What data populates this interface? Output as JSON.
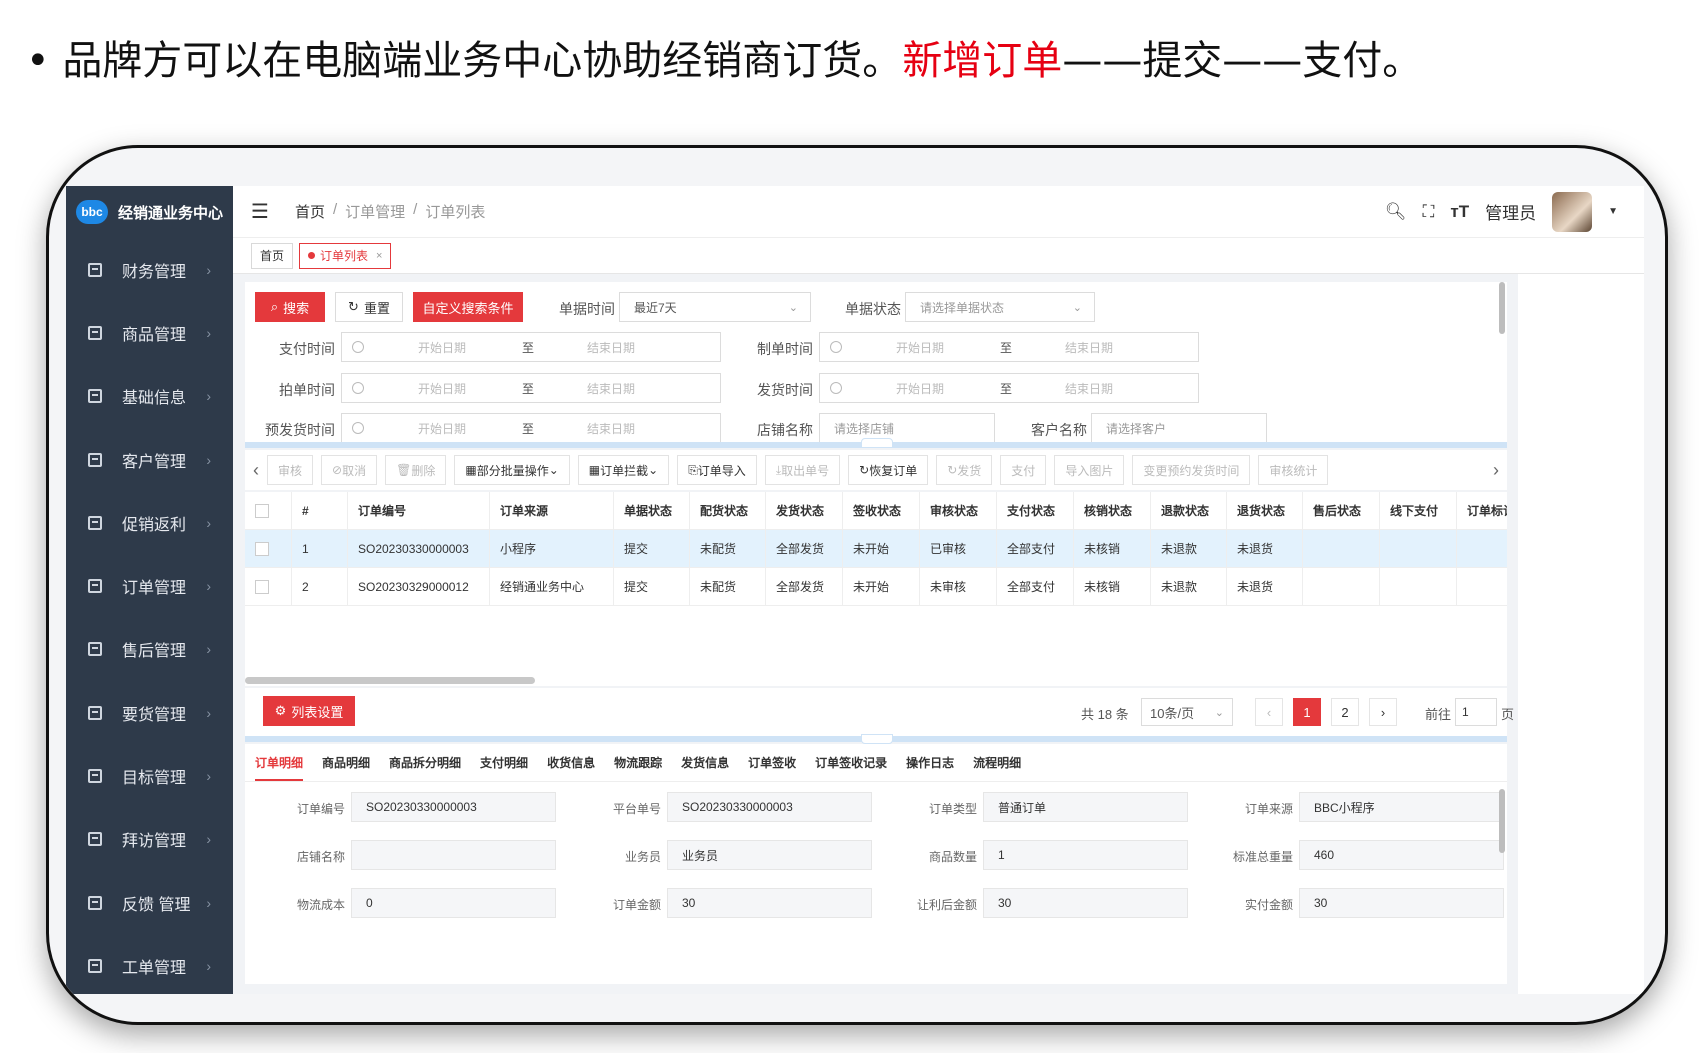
{
  "caption": {
    "text": "品牌方可以在电脑端业务中心协助经销商订货。",
    "highlight": "新增订单",
    "rest": "——提交——支付。"
  },
  "app": {
    "logo_text": "bbc",
    "title": "经销通业务中心"
  },
  "sidebar": {
    "items": [
      {
        "label": "财务管理"
      },
      {
        "label": "商品管理"
      },
      {
        "label": "基础信息"
      },
      {
        "label": "客户管理"
      },
      {
        "label": "促销返利"
      },
      {
        "label": "订单管理"
      },
      {
        "label": "售后管理"
      },
      {
        "label": "要货管理"
      },
      {
        "label": "目标管理"
      },
      {
        "label": "拜访管理"
      },
      {
        "label": "反馈 管理"
      },
      {
        "label": "工单管理"
      }
    ]
  },
  "header": {
    "breadcrumb": [
      "首页",
      "/",
      "订单管理",
      "/",
      "订单列表"
    ],
    "user": "管理员"
  },
  "tags": {
    "home": "首页",
    "current": "订单列表",
    "close": "×"
  },
  "filter": {
    "search": "搜索",
    "reset": "重置",
    "custom": "自定义搜索条件",
    "doc_time_label": "单据时间",
    "doc_time_value": "最近7天",
    "doc_status_label": "单据状态",
    "doc_status_placeholder": "请选择单据状态",
    "pay_time": "支付时间",
    "make_time": "制单时间",
    "shoot_time": "拍单时间",
    "ship_time": "发货时间",
    "preship_time": "预发货时间",
    "shop_label": "店铺名称",
    "shop_placeholder": "请选择店铺",
    "customer_label": "客户名称",
    "customer_placeholder": "请选择客户",
    "start": "开始日期",
    "to": "至",
    "end": "结束日期"
  },
  "toolbar": [
    "审核",
    "取消",
    "删除",
    "部分批量操作",
    "订单拦截",
    "订单导入",
    "取出单号",
    "恢复订单",
    "发货",
    "支付",
    "导入图片",
    "变更预约发货时间",
    "审核统计"
  ],
  "table": {
    "headers": [
      "#",
      "订单编号",
      "订单来源",
      "单据状态",
      "配货状态",
      "发货状态",
      "签收状态",
      "审核状态",
      "支付状态",
      "核销状态",
      "退款状态",
      "退货状态",
      "售后状态",
      "线下支付",
      "订单标记"
    ],
    "rows": [
      [
        "1",
        "SO20230330000003",
        "小程序",
        "提交",
        "未配货",
        "全部发货",
        "未开始",
        "已审核",
        "全部支付",
        "未核销",
        "未退款",
        "未退货",
        "",
        "",
        ""
      ],
      [
        "2",
        "SO20230329000012",
        "经销通业务中心",
        "提交",
        "未配货",
        "全部发货",
        "未开始",
        "未审核",
        "全部支付",
        "未核销",
        "未退款",
        "未退货",
        "",
        "",
        ""
      ]
    ]
  },
  "pagination": {
    "settings": "列表设置",
    "total": "共 18 条",
    "page_size": "10条/页",
    "pages": [
      "1",
      "2"
    ],
    "goto": "前往",
    "goto_value": "1",
    "page_unit": "页"
  },
  "detail": {
    "tabs": [
      "订单明细",
      "商品明细",
      "商品拆分明细",
      "支付明细",
      "收货信息",
      "物流跟踪",
      "发货信息",
      "订单签收",
      "订单签收记录",
      "操作日志",
      "流程明细"
    ],
    "fields": [
      {
        "label": "订单编号",
        "value": "SO20230330000003"
      },
      {
        "label": "平台单号",
        "value": "SO20230330000003"
      },
      {
        "label": "订单类型",
        "value": "普通订单"
      },
      {
        "label": "订单来源",
        "value": "BBC小程序"
      },
      {
        "label": "店铺名称",
        "value": ""
      },
      {
        "label": "业务员",
        "value": "业务员"
      },
      {
        "label": "商品数量",
        "value": "1"
      },
      {
        "label": "标准总重量",
        "value": "460"
      },
      {
        "label": "物流成本",
        "value": "0"
      },
      {
        "label": "订单金额",
        "value": "30"
      },
      {
        "label": "让利后金额",
        "value": "30"
      },
      {
        "label": "实付金额",
        "value": "30"
      }
    ]
  },
  "colors": {
    "accent": "#e4393c",
    "sidebar": "#2e3a4a",
    "row_highlight": "#e3f2fd"
  }
}
